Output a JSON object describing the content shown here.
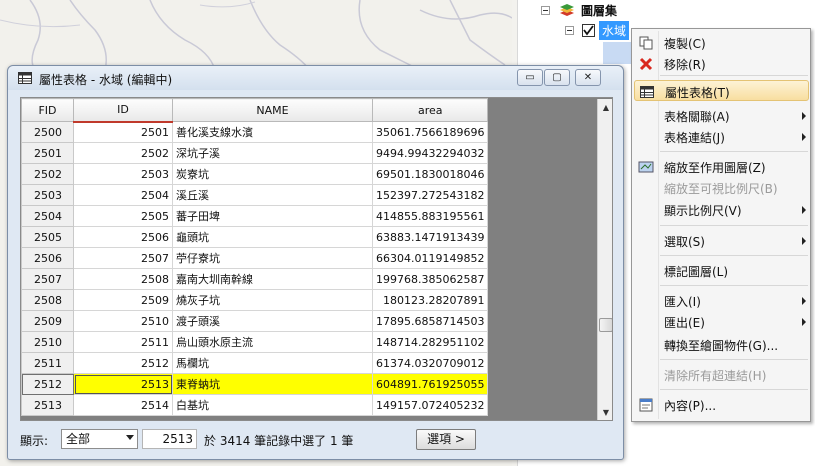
{
  "toc": {
    "group_label": "圖層集",
    "layer_label": "水域"
  },
  "window": {
    "title": "屬性表格 - 水域 (編輯中)",
    "minimize_glyph": "▭",
    "restore_glyph": "▢",
    "close_glyph": "✕"
  },
  "table": {
    "columns": [
      "FID",
      "ID",
      "NAME",
      "area"
    ],
    "rows": [
      {
        "fid": "2500",
        "id": "2501",
        "name": "善化溪支線水濱",
        "area": "35061.7566189696"
      },
      {
        "fid": "2501",
        "id": "2502",
        "name": "深坑子溪",
        "area": "9494.99432294032"
      },
      {
        "fid": "2502",
        "id": "2503",
        "name": "炭寮坑",
        "area": "69501.1830018046"
      },
      {
        "fid": "2503",
        "id": "2504",
        "name": "溪丘溪",
        "area": "152397.272543182"
      },
      {
        "fid": "2504",
        "id": "2505",
        "name": "蕃子田埤",
        "area": "414855.883195561"
      },
      {
        "fid": "2505",
        "id": "2506",
        "name": "龜頭坑",
        "area": "63883.1471913439"
      },
      {
        "fid": "2506",
        "id": "2507",
        "name": "苧仔寮坑",
        "area": "66304.0119149852"
      },
      {
        "fid": "2507",
        "id": "2508",
        "name": "嘉南大圳南幹線",
        "area": "199768.385062587"
      },
      {
        "fid": "2508",
        "id": "2509",
        "name": "燒灰子坑",
        "area": "180123.28207891"
      },
      {
        "fid": "2509",
        "id": "2510",
        "name": "渡子頭溪",
        "area": "17895.6858714503"
      },
      {
        "fid": "2510",
        "id": "2511",
        "name": "烏山頭水原主流",
        "area": "148714.282951102"
      },
      {
        "fid": "2511",
        "id": "2512",
        "name": "馬欄坑",
        "area": "61374.0320709012"
      },
      {
        "fid": "2512",
        "id": "2513",
        "name": "東脊蚋坑",
        "area": "604891.761925055",
        "selected": true
      },
      {
        "fid": "2513",
        "id": "2514",
        "name": "白基坑",
        "area": "149157.072405232"
      }
    ]
  },
  "footer": {
    "show_label": "顯示:",
    "show_value": "全部",
    "record_value": "2513",
    "status_text": "於 3414 筆記錄中選了 1 筆",
    "options_label": "選項 >"
  },
  "context_menu": {
    "items": [
      {
        "label": "複製(C)",
        "icon": "copy-icon",
        "name": "menu-item-copy"
      },
      {
        "label": "移除(R)",
        "icon": "remove-icon",
        "name": "menu-item-remove"
      },
      {
        "label": "屬性表格(T)",
        "icon": "table-icon",
        "name": "menu-item-attribute-table",
        "highlight": true
      },
      {
        "label": "表格關聯(A)",
        "name": "menu-item-table-relate",
        "submenu": true
      },
      {
        "label": "表格連結(J)",
        "name": "menu-item-table-join",
        "submenu": true
      },
      {
        "label": "縮放至作用圖層(Z)",
        "icon": "zoom-layer-icon",
        "name": "menu-item-zoom-to-layer"
      },
      {
        "label": "縮放至可視比例尺(B)",
        "name": "menu-item-zoom-visible-scale",
        "disabled": true
      },
      {
        "label": "顯示比例尺(V)",
        "name": "menu-item-visible-scale",
        "submenu": true
      },
      {
        "label": "選取(S)",
        "name": "menu-item-selection",
        "submenu": true
      },
      {
        "label": "標記圖層(L)",
        "name": "menu-item-label-layer"
      },
      {
        "label": "匯入(I)",
        "name": "menu-item-import",
        "submenu": true
      },
      {
        "label": "匯出(E)",
        "name": "menu-item-export",
        "submenu": true
      },
      {
        "label": "轉換至繪圖物件(G)...",
        "name": "menu-item-convert-graphics"
      },
      {
        "label": "清除所有超連結(H)",
        "name": "menu-item-clear-hyperlinks",
        "disabled": true
      },
      {
        "label": "內容(P)...",
        "icon": "properties-icon",
        "name": "menu-item-properties"
      }
    ]
  },
  "colors": {
    "selection_row": "#ffff00",
    "toc_selection": "#3399ff",
    "water": "#c8daf3"
  }
}
